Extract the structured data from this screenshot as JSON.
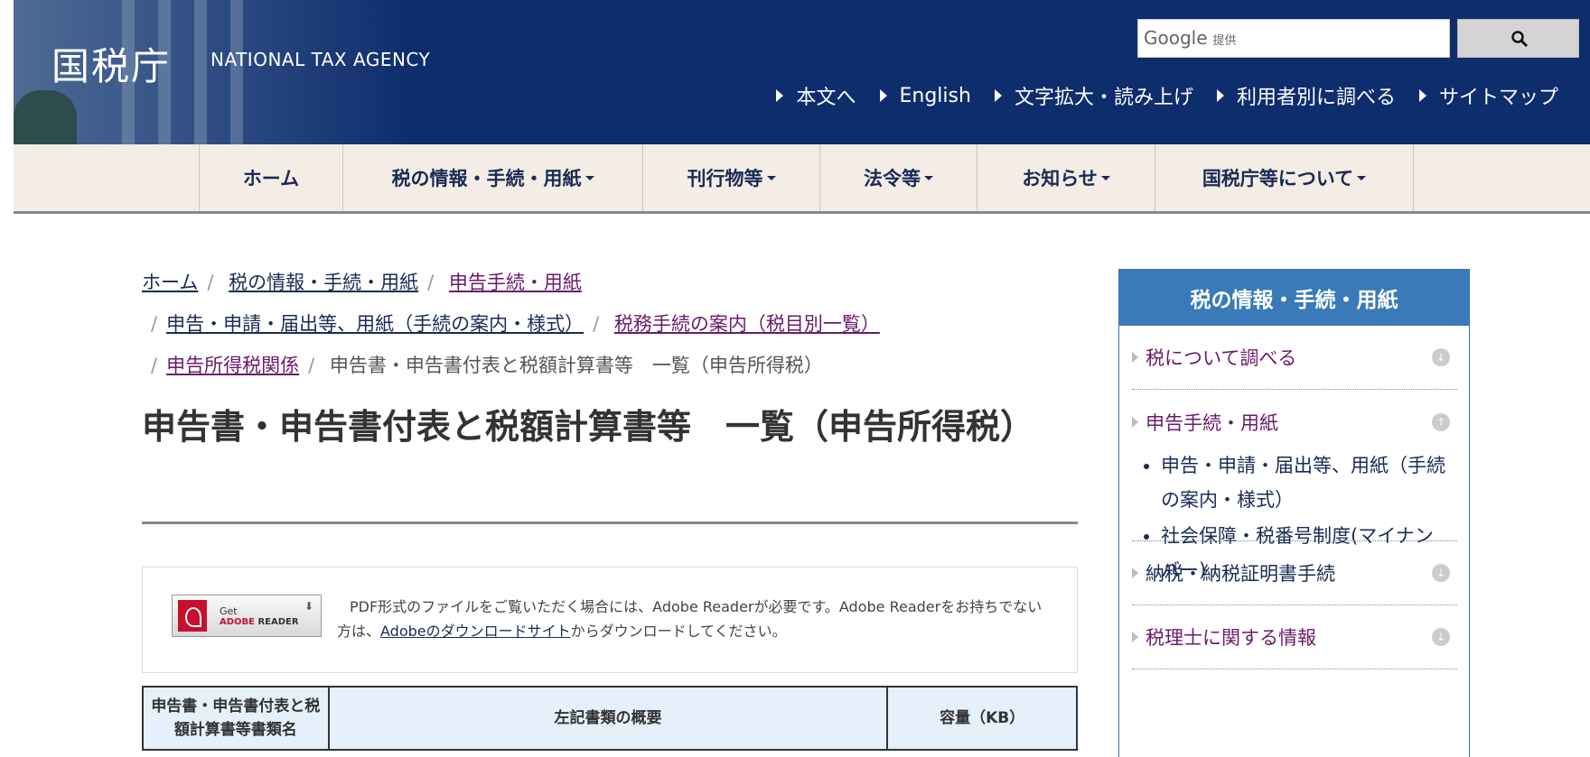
{
  "header": {
    "logo_jp": "国税庁",
    "logo_en": "NATIONAL TAX AGENCY",
    "search_brand": "Google",
    "search_brand_sub": "提供",
    "util_links": [
      "本文へ",
      "English",
      "文字拡大・読み上げ",
      "利用者別に調べる",
      "サイトマップ"
    ]
  },
  "gnav": [
    "ホーム",
    "税の情報・手続・用紙",
    "刊行物等",
    "法令等",
    "お知らせ",
    "国税庁等について"
  ],
  "breadcrumb": {
    "items": [
      "ホーム",
      "税の情報・手続・用紙",
      "申告手続・用紙",
      "申告・申請・届出等、用紙（手続の案内・様式）",
      "税務手続の案内（税目別一覧）",
      "申告所得税関係"
    ],
    "current": "申告書・申告書付表と税額計算書等　一覧（申告所得税）"
  },
  "page_title": "申告書・申告書付表と税額計算書等　一覧（申告所得税）",
  "adobe": {
    "badge_get": "Get",
    "badge_reader_a": "ADOBE",
    "badge_reader_b": "READER",
    "text_before": "PDF形式のファイルをご覧いただく場合には、Adobe Readerが必要です。Adobe Readerをお持ちでない方は、",
    "link": "Adobeのダウンロードサイト",
    "text_after": "からダウンロードしてください。"
  },
  "table": {
    "headers": [
      "申告書・申告書付表と税額計算書等書類名",
      "左記書類の概要",
      "容量（KB）"
    ]
  },
  "sidebar": {
    "title": "税の情報・手続・用紙",
    "items": [
      "税について調べる",
      "申告手続・用紙",
      "納税・納税証明書手続",
      "税理士に関する情報"
    ],
    "sub_items": [
      "申告・申請・届出等、用紙（手続の案内・様式）",
      "社会保障・税番号制度(マイナンバー)"
    ]
  }
}
